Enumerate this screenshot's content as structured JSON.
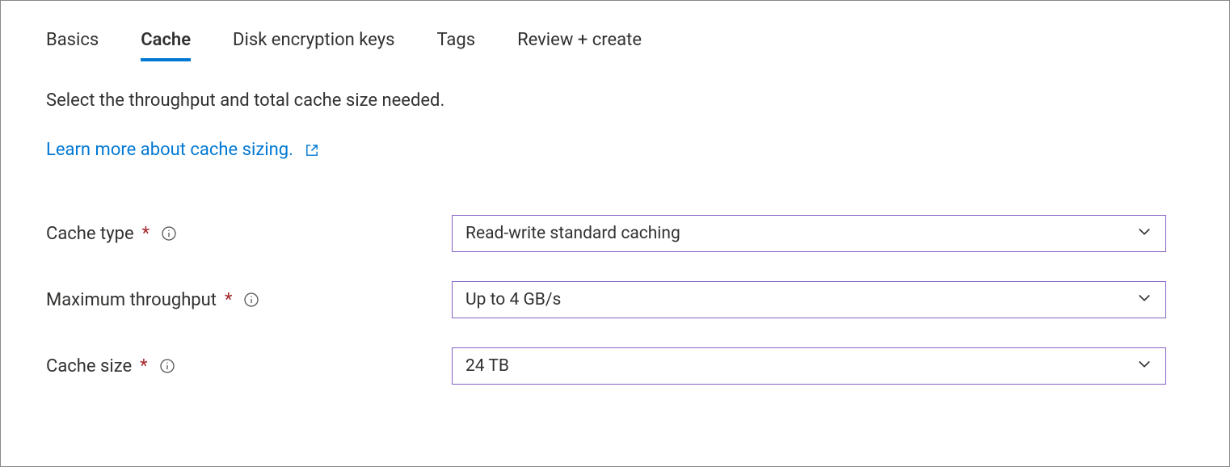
{
  "tabs": {
    "basics": "Basics",
    "cache": "Cache",
    "disk_encryption_keys": "Disk encryption keys",
    "tags": "Tags",
    "review_create": "Review + create"
  },
  "description": "Select the throughput and total cache size needed.",
  "learn_link": "Learn more about cache sizing.",
  "form": {
    "cache_type": {
      "label": "Cache type",
      "value": "Read-write standard caching"
    },
    "max_throughput": {
      "label": "Maximum throughput",
      "value": "Up to 4 GB/s"
    },
    "cache_size": {
      "label": "Cache size",
      "value": "24 TB"
    }
  }
}
